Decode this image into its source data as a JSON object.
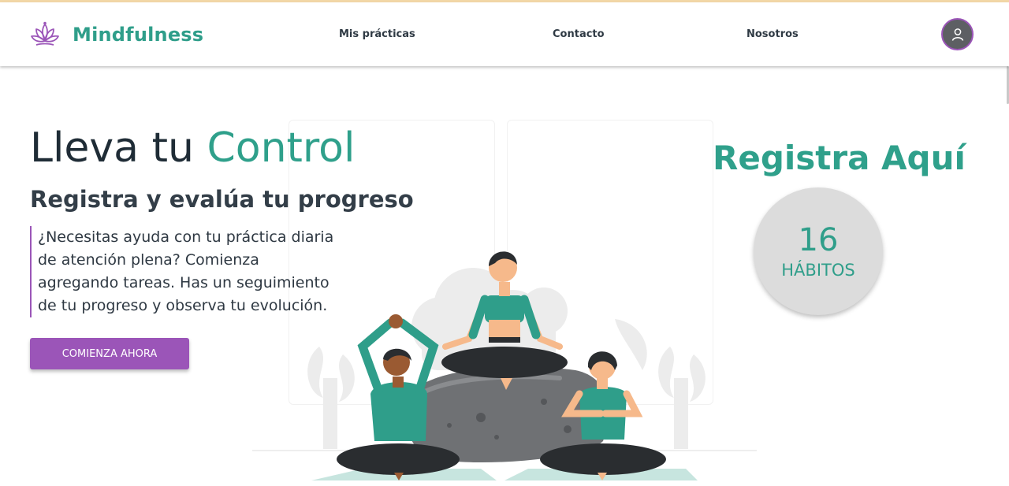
{
  "brand": {
    "name": "Mindfulness",
    "logo_icon": "lotus-icon",
    "accent_color": "#2f9e8a",
    "logo_color": "#9b55b8"
  },
  "nav": {
    "links": [
      {
        "label": "Mis prácticas"
      },
      {
        "label": "Contacto"
      },
      {
        "label": "Nosotros"
      }
    ],
    "avatar_icon": "user-icon"
  },
  "hero": {
    "title_main": "Lleva tu ",
    "title_accent": "Control",
    "subtitle": "Registra y evalúa tu progreso",
    "text": "¿Necesitas ayuda con tu práctica diaria de atención plena? Comienza agregando tareas. Has un seguimiento de tu progreso y observa tu evolución.",
    "cta_label": "COMIENZA AHORA",
    "cta_color": "#9b55b8"
  },
  "register": {
    "title": "Registra Aquí",
    "habit_count": "16",
    "habit_label": "HÁBITOS"
  }
}
